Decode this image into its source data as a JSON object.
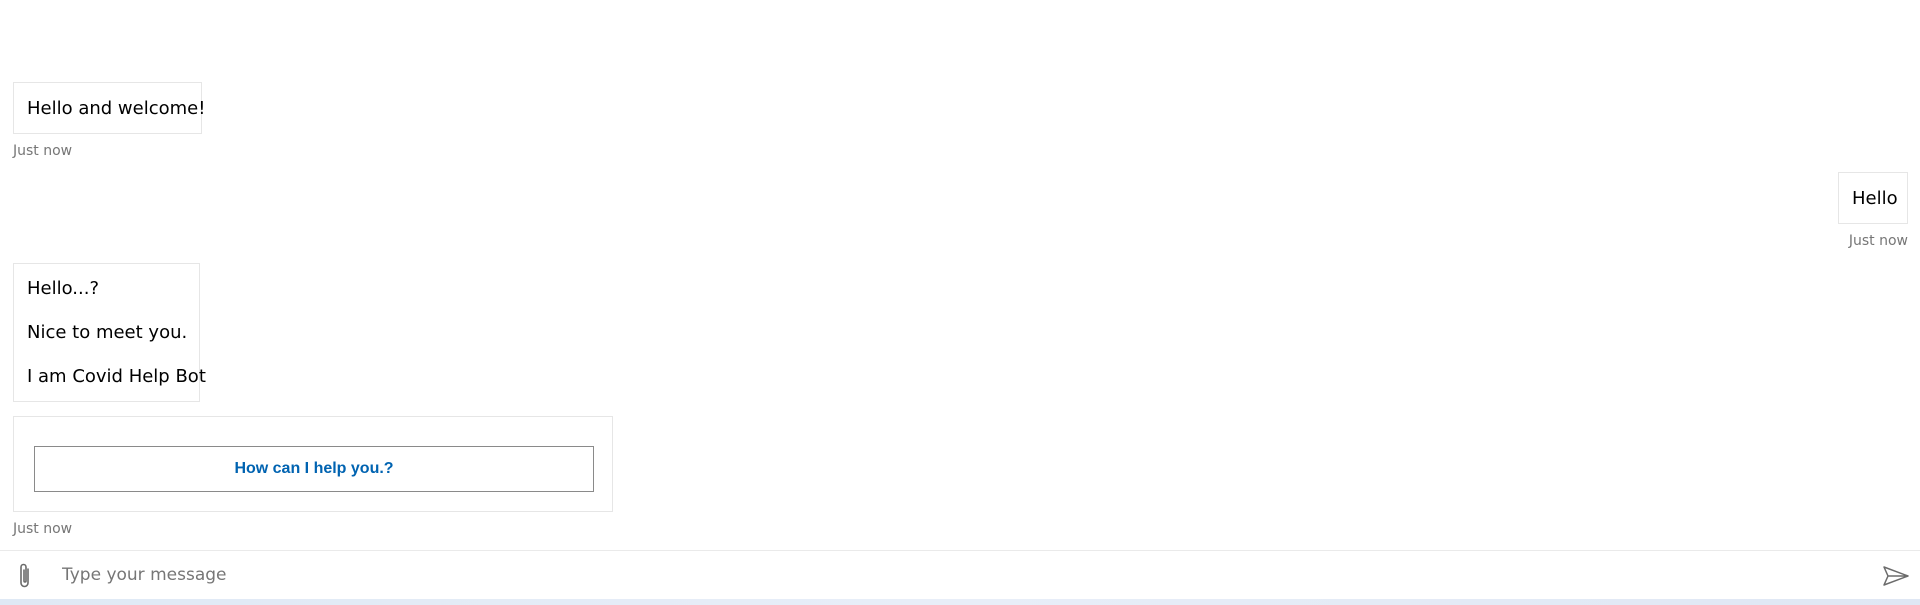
{
  "transcript": {
    "welcome": {
      "text": "Hello and welcome!",
      "timestamp": "Just now"
    },
    "user_message": {
      "text": "Hello",
      "timestamp": "Just now"
    },
    "bot_intro": {
      "lines": [
        "Hello...?",
        "Nice to meet you.",
        "I am Covid Help Bot"
      ]
    },
    "card": {
      "action_label": "How can I help you.?",
      "timestamp": "Just now"
    }
  },
  "input": {
    "placeholder": "Type your message",
    "value": ""
  },
  "icons": {
    "attach": "paperclip-icon",
    "send": "send-icon"
  },
  "colors": {
    "action_text": "#0063b1",
    "timestamp": "#767676",
    "bubble_border": "#e6e6e6"
  }
}
